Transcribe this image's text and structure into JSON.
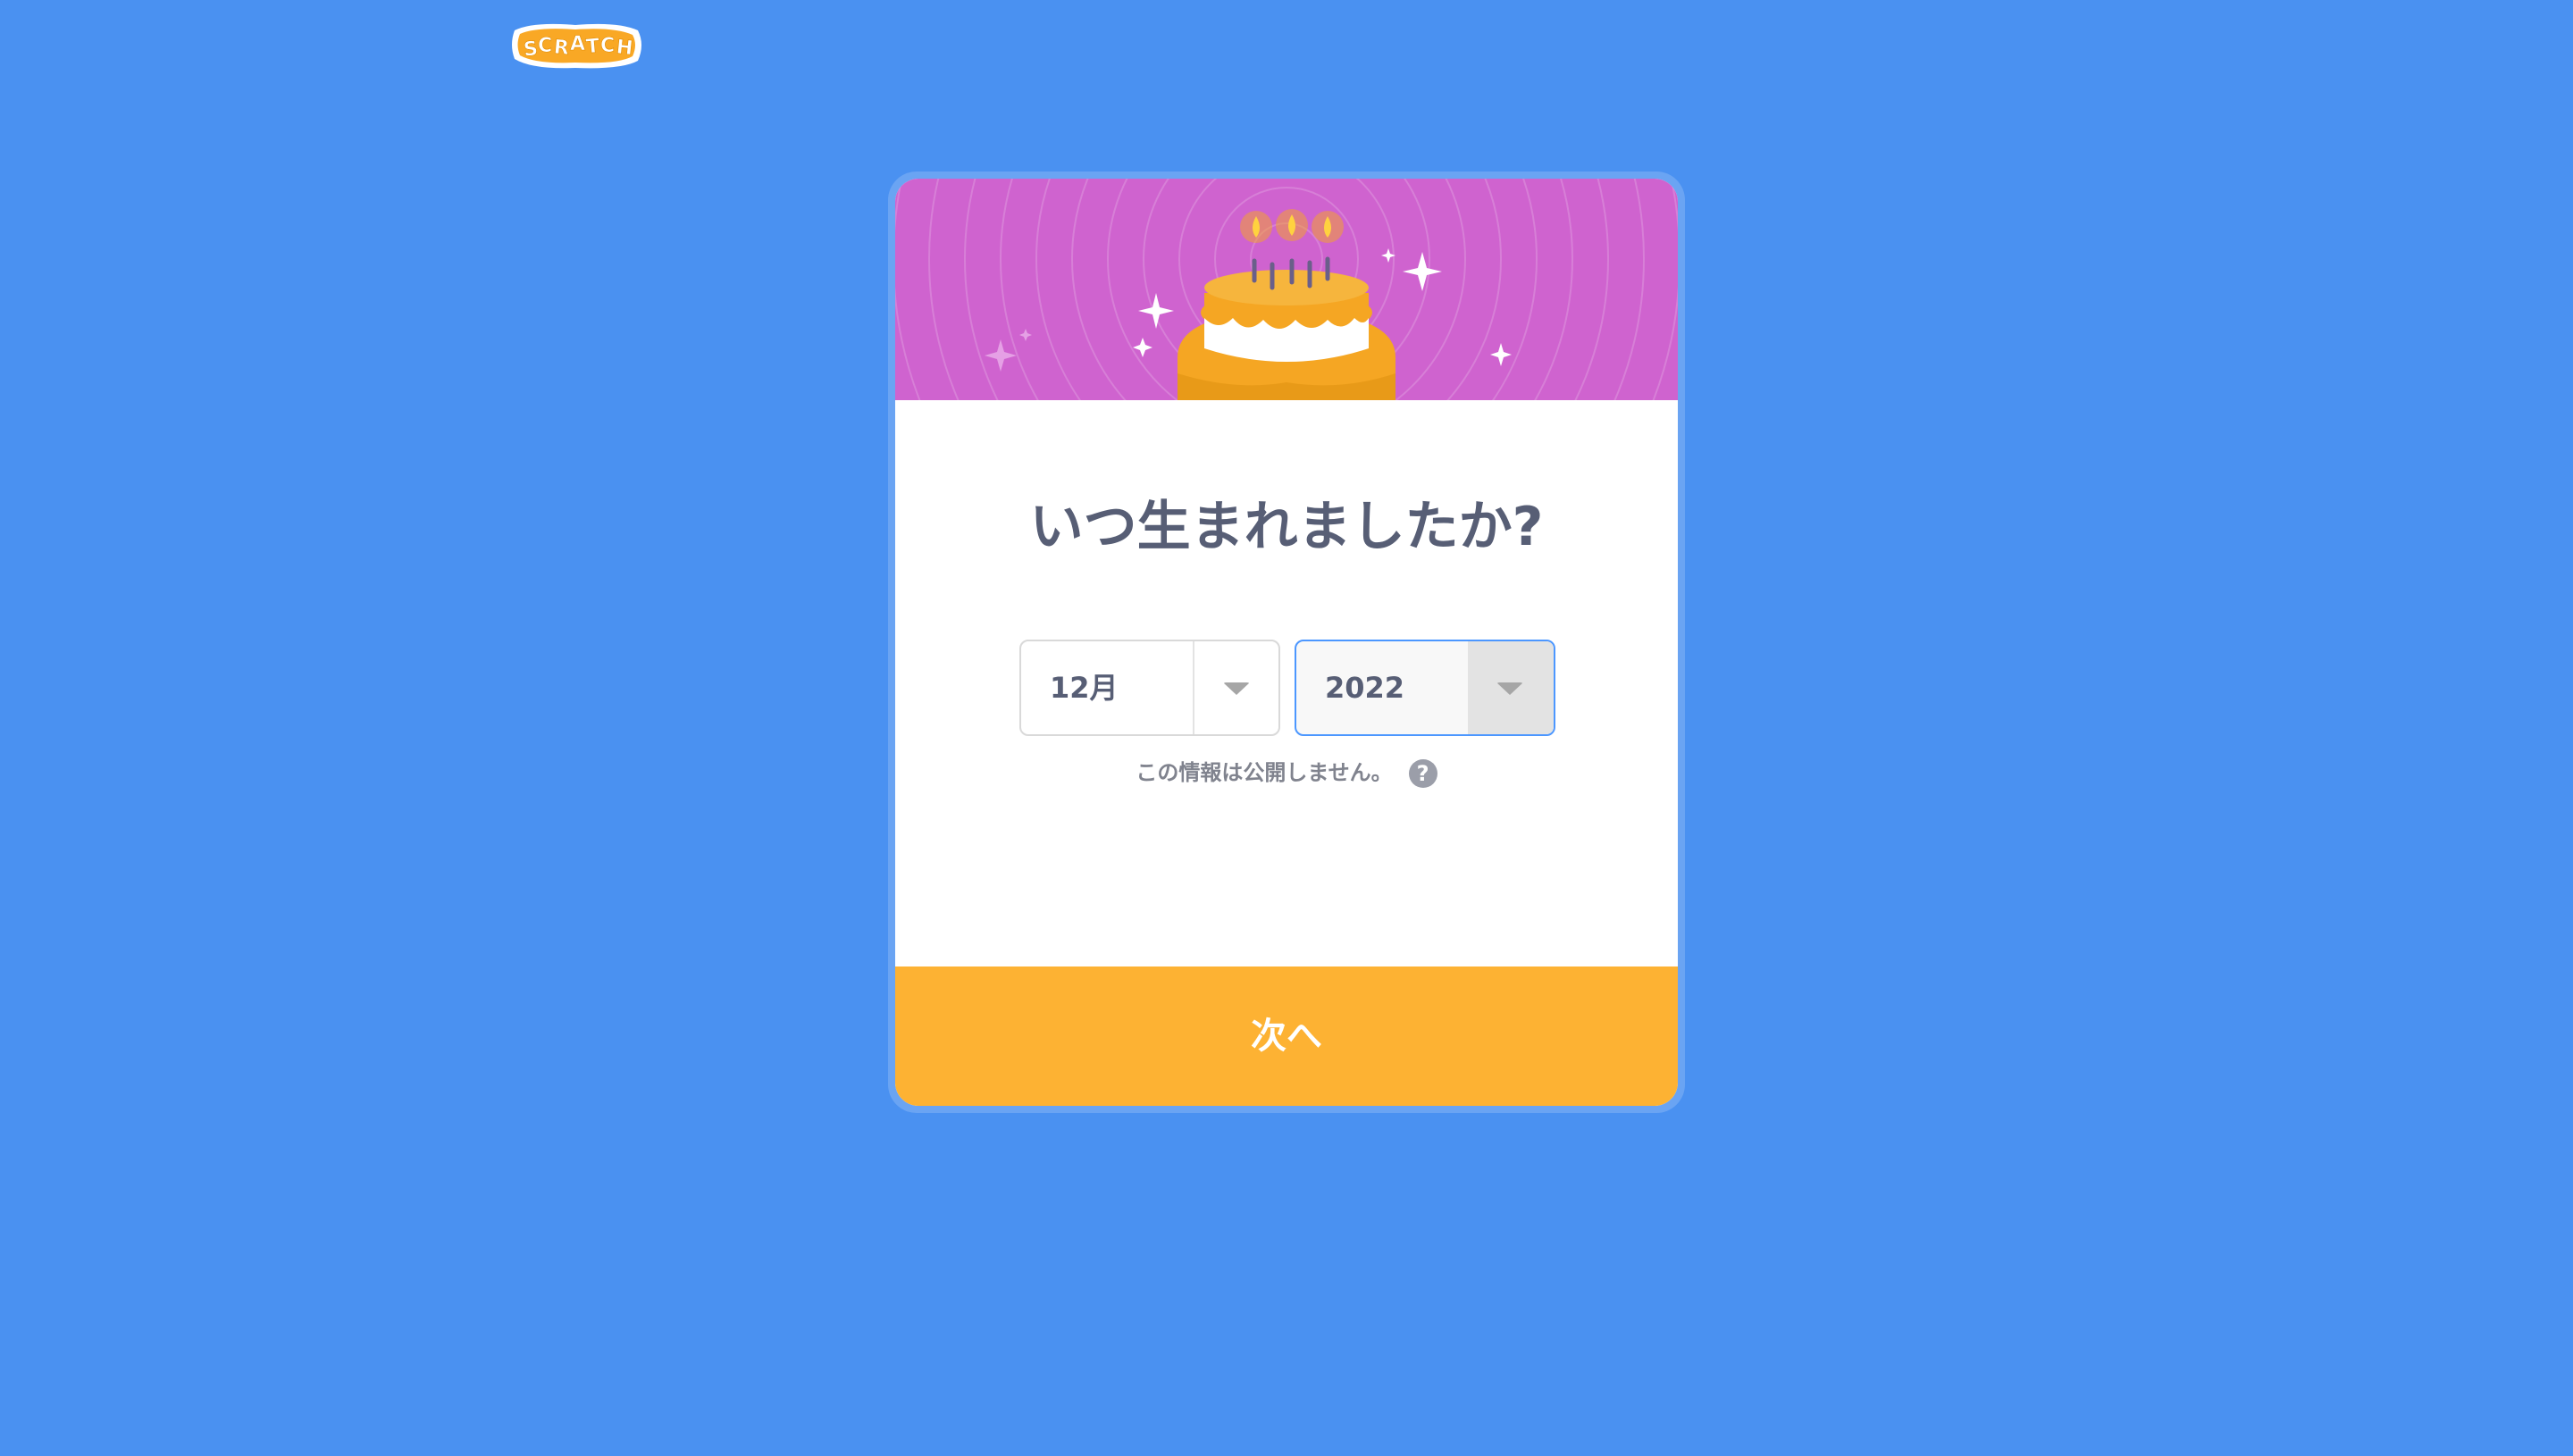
{
  "logo": {
    "text": "SCRATCH",
    "icon": "scratch-logo"
  },
  "colors": {
    "background": "#4a91f1",
    "banner": "#cf63cf",
    "button": "#fdb233",
    "title": "#575e75",
    "select_focus_border": "#4c97ff"
  },
  "banner": {
    "icon": "birthday-cake-illustration"
  },
  "dialog": {
    "title": "いつ生まれましたか?",
    "month_select": {
      "value": "12月",
      "icon": "chevron-down-icon"
    },
    "year_select": {
      "value": "2022",
      "icon": "chevron-down-icon"
    },
    "privacy_note": "この情報は公開しません。",
    "help_icon": "?",
    "next_label": "次へ"
  }
}
